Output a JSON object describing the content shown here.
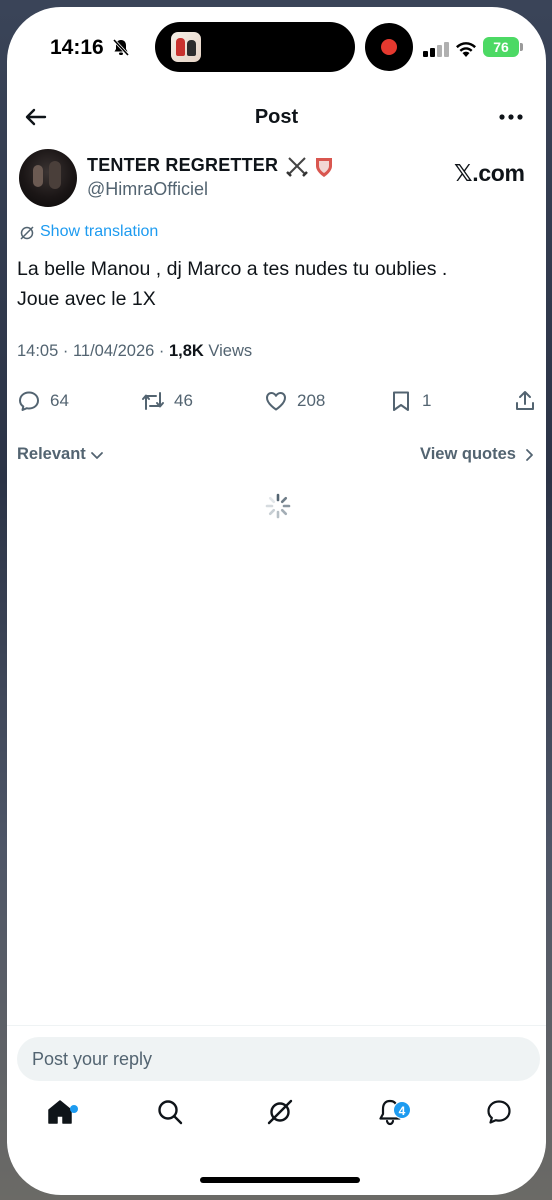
{
  "status_bar": {
    "time": "14:16",
    "battery": "76"
  },
  "header": {
    "title": "Post"
  },
  "post": {
    "display_name": "TENTER REGRETTER",
    "name_emoji": "⚔️🛡️",
    "handle": "@HimraOfficiel",
    "watermark": "𝕏.com",
    "translation_label": "Show translation",
    "text_line1": "La belle Manou , dj Marco a tes nudes tu oublies .",
    "text_line2": "Joue avec le 1X",
    "timestamp": "14:05 · 11/04/2026 · ",
    "views_count": "1,8K",
    "views_label": " Views"
  },
  "actions": {
    "replies": "64",
    "reposts": "46",
    "likes": "208",
    "bookmarks": "1"
  },
  "replies_section": {
    "sort_label": "Relevant",
    "view_quotes_label": "View quotes"
  },
  "reply_input": {
    "placeholder": "Post your reply"
  },
  "tabbar": {
    "notifications_badge": "4"
  },
  "colors": {
    "accent": "#1d9bf0",
    "text": "#0f1419",
    "muted": "#536471",
    "battery": "#4cd964",
    "record": "#e5392f"
  },
  "icons": [
    "bell-slash-icon",
    "signal-icon",
    "wifi-icon",
    "battery-icon",
    "back-arrow-icon",
    "more-icon",
    "translate-icon",
    "reply-icon",
    "repost-icon",
    "like-icon",
    "bookmark-icon",
    "share-icon",
    "chevron-down-icon",
    "chevron-right-icon",
    "loading-spinner-icon",
    "home-icon",
    "search-icon",
    "grok-icon",
    "notifications-icon",
    "messages-icon"
  ]
}
